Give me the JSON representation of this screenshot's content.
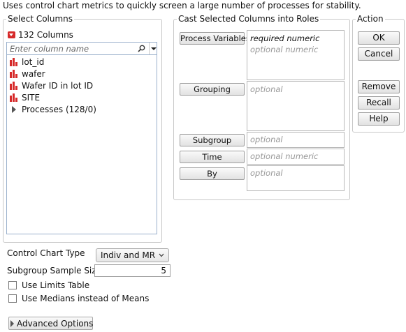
{
  "description": "Uses control chart metrics to quickly screen a large number of processes for stability.",
  "select_columns": {
    "legend": "Select Columns",
    "count_label": "132 Columns",
    "search_placeholder": "Enter column name",
    "items": [
      {
        "label": "lot_id",
        "icon": "bar-chart-icon"
      },
      {
        "label": "wafer",
        "icon": "bar-chart-icon"
      },
      {
        "label": "Wafer ID in lot ID",
        "icon": "bar-chart-icon"
      },
      {
        "label": "SITE",
        "icon": "bar-chart-icon"
      },
      {
        "label": "Processes (128/0)",
        "icon": "expand-triangle-icon"
      }
    ]
  },
  "cast_roles": {
    "legend": "Cast Selected Columns into Roles",
    "process_variables": {
      "label": "Process Variables",
      "line1": "required numeric",
      "line2": "optional numeric"
    },
    "grouping": {
      "label": "Grouping",
      "hint": "optional"
    },
    "subgroup": {
      "label": "Subgroup",
      "hint": "optional"
    },
    "time": {
      "label": "Time",
      "hint": "optional numeric"
    },
    "by": {
      "label": "By",
      "hint": "optional"
    }
  },
  "action": {
    "legend": "Action",
    "ok": "OK",
    "cancel": "Cancel",
    "remove": "Remove",
    "recall": "Recall",
    "help": "Help"
  },
  "options": {
    "control_chart_type_label": "Control Chart Type",
    "control_chart_type_value": "Indiv and MR",
    "subgroup_size_label": "Subgroup Sample Size",
    "subgroup_size_value": "5",
    "use_limits_table": "Use Limits Table",
    "use_limits_table_checked": false,
    "use_medians": "Use Medians instead of Means",
    "use_medians_checked": false,
    "advanced_options": "Advanced Options"
  },
  "colors": {
    "column_icon": "#d62a2a",
    "button_border": "#9e9e9e",
    "list_border": "#9ab0cc"
  }
}
